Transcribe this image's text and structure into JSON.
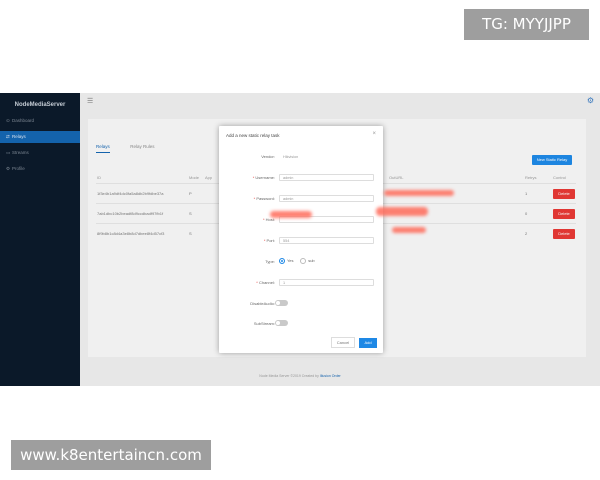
{
  "watermark": {
    "top": "TG: MYYJJPP",
    "bottom": "www.k8entertaincn.com"
  },
  "app": {
    "brand": "NodeMediaServer",
    "nav": [
      {
        "icon": "dashboard-icon",
        "glyph": "⊙",
        "label": "Dashboard"
      },
      {
        "icon": "relay-icon",
        "glyph": "⇄",
        "label": "Relays"
      },
      {
        "icon": "streams-icon",
        "glyph": "▭",
        "label": "Streams"
      },
      {
        "icon": "profile-icon",
        "glyph": "⚙",
        "label": "Profile"
      }
    ],
    "active_nav": 1
  },
  "main": {
    "tabs": [
      "Relays",
      "Relay Rules"
    ],
    "active_tab": 0,
    "add_button": "New Static Relay",
    "columns": [
      "ID",
      "Mode",
      "App",
      "",
      "",
      "",
      "OutURL",
      "Retrys",
      "Control"
    ],
    "rows": [
      {
        "id": "1f3e4b1a9df4dc0fa5a8db2b9fdbe37a",
        "mode": "P",
        "retrys": "1",
        "control": "Delete"
      },
      {
        "id": "7ab1dbc10b2beadf8d9ccdbadf97fb1f",
        "mode": "S",
        "retrys": "0",
        "control": "Delete"
      },
      {
        "id": "8f9b8b1c8d4a3e8b8d7dbee8f4d57cf3",
        "mode": "S",
        "retrys": "2",
        "control": "Delete"
      }
    ],
    "footer_text": "Node Media Server ©2019 Created by",
    "footer_link": "Illusion Order"
  },
  "modal": {
    "title": "Add a new static relay task",
    "fields": {
      "vendor": {
        "label": "Vendor",
        "value": "Hikvision",
        "required": false
      },
      "username": {
        "label": "Username",
        "value": "admin",
        "required": true
      },
      "password": {
        "label": "Password",
        "value": "admin",
        "required": true
      },
      "host": {
        "label": "Host",
        "value": "",
        "required": true
      },
      "port": {
        "label": "Port",
        "value": "554",
        "required": true
      },
      "type": {
        "label": "Type",
        "options": [
          "Yes",
          "sub"
        ],
        "selected": 0
      },
      "channel": {
        "label": "Channel",
        "value": "1",
        "required": true
      },
      "disable_audio": {
        "label": "DisableAudio"
      },
      "sub_stream": {
        "label": "SubStream"
      }
    },
    "cancel": "Cancel",
    "ok": "Add"
  },
  "colors": {
    "sidebar": "#0c1a2a",
    "accent": "#1e88e5",
    "danger": "#e53935",
    "redaction": "#ff6b5a"
  }
}
